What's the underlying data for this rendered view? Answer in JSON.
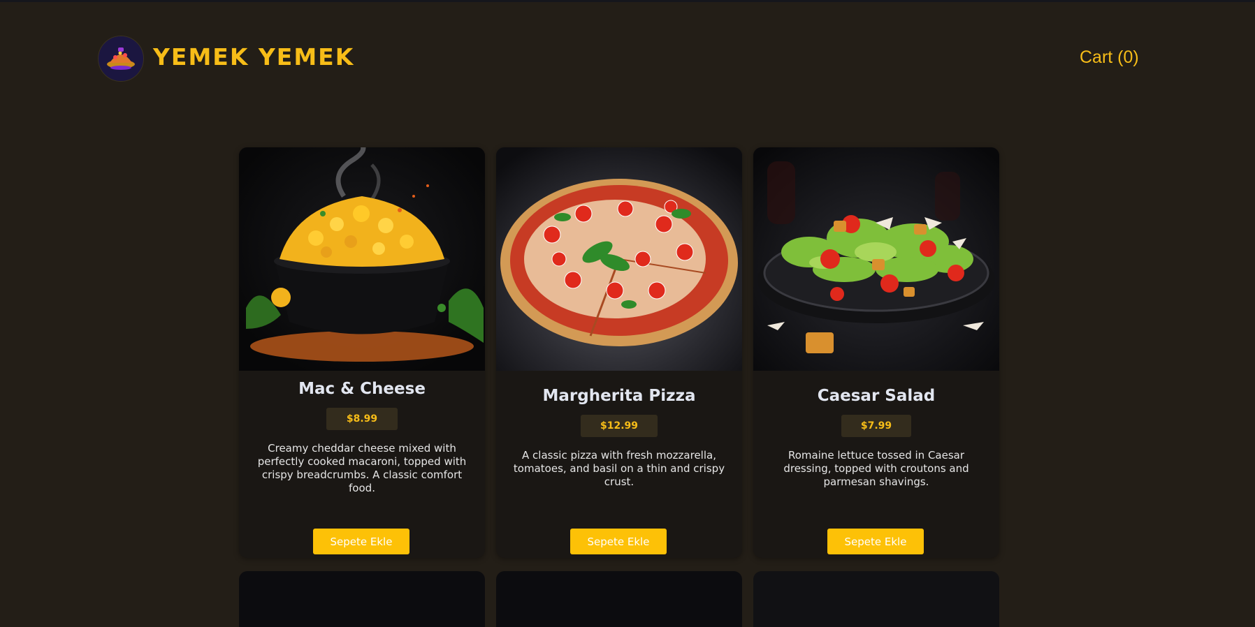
{
  "header": {
    "brand": "YEMEK YEMEK",
    "cart_label": "Cart (0)"
  },
  "products": [
    {
      "name": "Mac & Cheese",
      "price": "$8.99",
      "description": "Creamy cheddar cheese mixed with perfectly cooked macaroni, topped with crispy breadcrumbs. A classic comfort food.",
      "button": "Sepete Ekle",
      "image": "mac-and-cheese-bowl-photo"
    },
    {
      "name": "Margherita Pizza",
      "price": "$12.99",
      "description": "A classic pizza with fresh mozzarella, tomatoes, and basil on a thin and crispy crust.",
      "button": "Sepete Ekle",
      "image": "margherita-pizza-photo"
    },
    {
      "name": "Caesar Salad",
      "price": "$7.99",
      "description": "Romaine lettuce tossed in Caesar dressing, topped with croutons and parmesan shavings.",
      "button": "Sepete Ekle",
      "image": "caesar-salad-plate-photo"
    }
  ],
  "colors": {
    "background": "#231e17",
    "accent": "#f7bd18",
    "button": "#fdc107",
    "card": "#1a1714"
  }
}
